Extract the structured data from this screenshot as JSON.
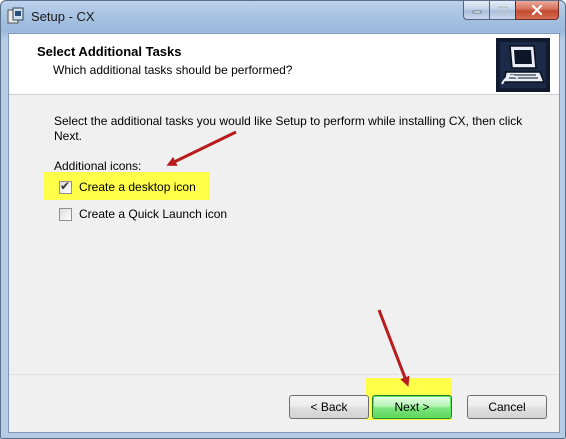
{
  "window": {
    "title": "Setup - CX"
  },
  "header": {
    "title": "Select Additional Tasks",
    "subtitle": "Which additional tasks should be performed?"
  },
  "body": {
    "description": "Select the additional tasks you would like Setup to perform while installing CX, then click Next.",
    "group_label": "Additional icons:",
    "options": [
      {
        "label": "Create a desktop icon",
        "checked": true
      },
      {
        "label": "Create a Quick Launch icon",
        "checked": false
      }
    ]
  },
  "buttons": {
    "back": "< Back",
    "next": "Next >",
    "cancel": "Cancel"
  },
  "colors": {
    "highlight": "#ffff4a",
    "annotation_arrow": "#b81c1c",
    "next_button": "#7fe57f"
  }
}
